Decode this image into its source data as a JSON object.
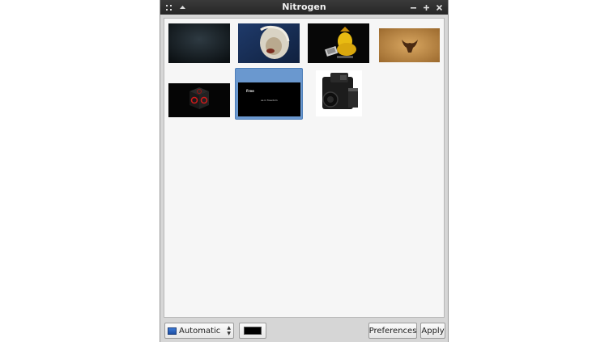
{
  "window": {
    "title": "Nitrogen"
  },
  "titlebar_icons": [
    "app-menu-icon",
    "shade-up-icon",
    "minimize-icon",
    "maximize-icon",
    "close-icon"
  ],
  "thumbnails": [
    {
      "name": "wallpaper-dark-texture",
      "selected": false
    },
    {
      "name": "wallpaper-lion",
      "selected": false
    },
    {
      "name": "wallpaper-yellow-gnu",
      "selected": false
    },
    {
      "name": "wallpaper-bull-parchment",
      "selected": false
    },
    {
      "name": "wallpaper-red-cube",
      "selected": false
    },
    {
      "name": "wallpaper-black-text",
      "selected": true,
      "line1": "Free",
      "line2": "as in freedom"
    },
    {
      "name": "wallpaper-camera",
      "selected": false
    }
  ],
  "bottom": {
    "mode_select_value": "Automatic",
    "bg_color": "#000000",
    "preferences_label": "Preferences",
    "apply_label": "Apply"
  },
  "colors": {
    "selection": "#6a98cf",
    "titlebar": "#2e2e2e"
  }
}
